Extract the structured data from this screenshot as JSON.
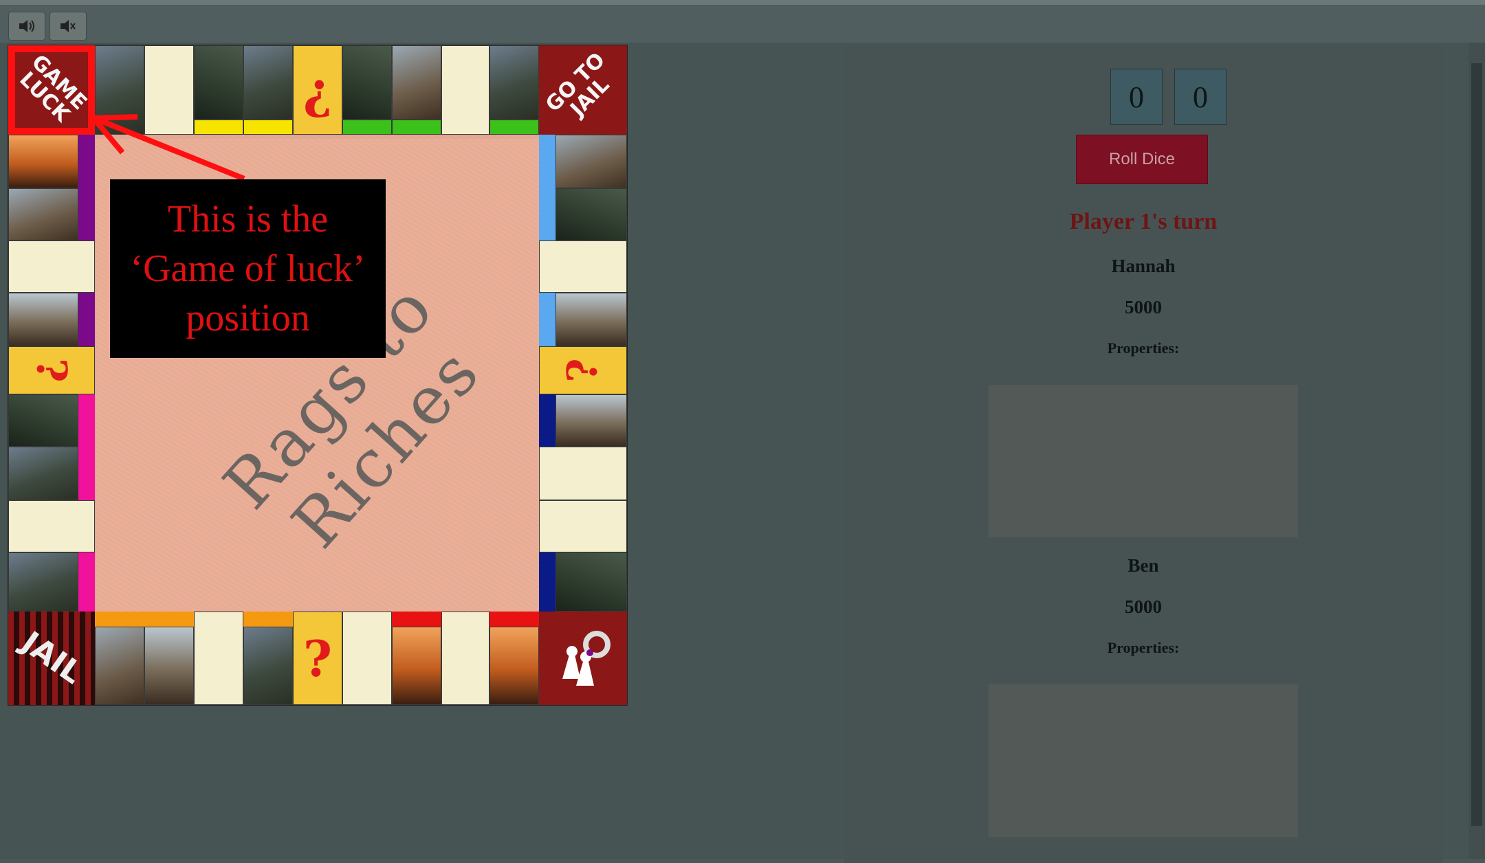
{
  "toolbar": {
    "sound_on": "speaker-icon",
    "sound_off": "mute-icon"
  },
  "board": {
    "title": "Rags to Riches",
    "corners": {
      "top_left": "GAME LUCK",
      "top_right": "GO TO JAIL",
      "bottom_left": "JAIL"
    },
    "question_marks": {
      "top": "¿",
      "left": "?",
      "right": "?",
      "bottom": "?"
    },
    "colors": {
      "yellow": "#f6e400",
      "green": "#3cc01a",
      "purple": "#7a0a8a",
      "pink": "#f0129a",
      "light_blue": "#5aa8f0",
      "navy": "#0a1a86",
      "orange": "#f59a10",
      "red": "#e81212"
    }
  },
  "annotation": {
    "line1": "This is the",
    "line2": "‘Game of luck’",
    "line3": "position"
  },
  "panel": {
    "die1": "0",
    "die2": "0",
    "roll_label": "Roll Dice",
    "turn": "Player 1's turn",
    "players": [
      {
        "name": "Hannah",
        "money": "5000",
        "properties_label": "Properties:"
      },
      {
        "name": "Ben",
        "money": "5000",
        "properties_label": "Properties:"
      }
    ]
  }
}
